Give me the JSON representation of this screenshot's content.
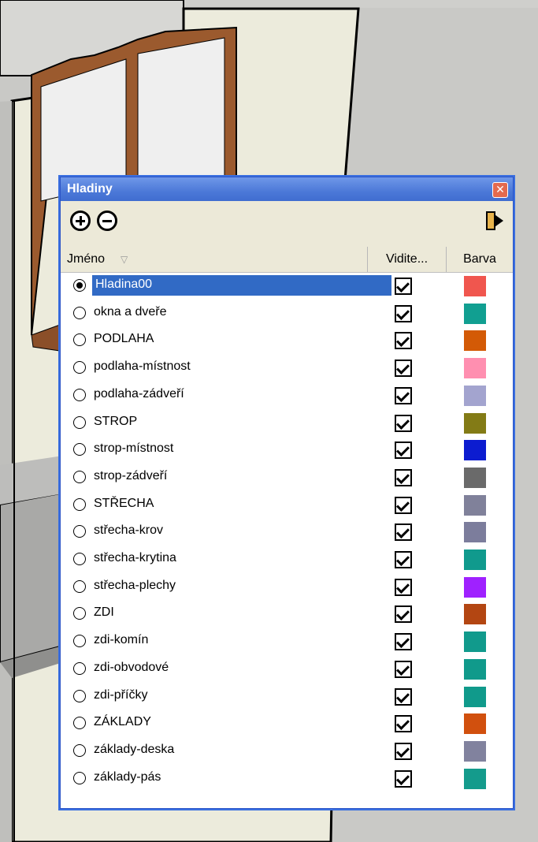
{
  "window": {
    "title": "Hladiny",
    "columns": {
      "name": "Jméno",
      "visible": "Vidite...",
      "color": "Barva"
    }
  },
  "layers": [
    {
      "name": "Hladina00",
      "active": true,
      "visible": true,
      "color": "#f0564e"
    },
    {
      "name": "okna a dveře",
      "active": false,
      "visible": true,
      "color": "#119f91"
    },
    {
      "name": "PODLAHA",
      "active": false,
      "visible": true,
      "color": "#d35a06"
    },
    {
      "name": "podlaha-místnost",
      "active": false,
      "visible": true,
      "color": "#ff8fb0"
    },
    {
      "name": "podlaha-zádveří",
      "active": false,
      "visible": true,
      "color": "#a3a4cf"
    },
    {
      "name": "STROP",
      "active": false,
      "visible": true,
      "color": "#837b16"
    },
    {
      "name": "strop-místnost",
      "active": false,
      "visible": true,
      "color": "#0c1cd0"
    },
    {
      "name": "strop-zádveří",
      "active": false,
      "visible": true,
      "color": "#6a6a6a"
    },
    {
      "name": "STŘECHA",
      "active": false,
      "visible": true,
      "color": "#80819a"
    },
    {
      "name": "střecha-krov",
      "active": false,
      "visible": true,
      "color": "#7c7d9c"
    },
    {
      "name": "střecha-krytina",
      "active": false,
      "visible": true,
      "color": "#109a8d"
    },
    {
      "name": "střecha-plechy",
      "active": false,
      "visible": true,
      "color": "#9f21ff"
    },
    {
      "name": "ZDI",
      "active": false,
      "visible": true,
      "color": "#b34612"
    },
    {
      "name": "zdi-komín",
      "active": false,
      "visible": true,
      "color": "#119a8c"
    },
    {
      "name": "zdi-obvodové",
      "active": false,
      "visible": true,
      "color": "#109a8b"
    },
    {
      "name": "zdi-příčky",
      "active": false,
      "visible": true,
      "color": "#109a8b"
    },
    {
      "name": "ZÁKLADY",
      "active": false,
      "visible": true,
      "color": "#d1500e"
    },
    {
      "name": "základy-deska",
      "active": false,
      "visible": true,
      "color": "#81829e"
    },
    {
      "name": "základy-pás",
      "active": false,
      "visible": true,
      "color": "#149b8c"
    }
  ]
}
